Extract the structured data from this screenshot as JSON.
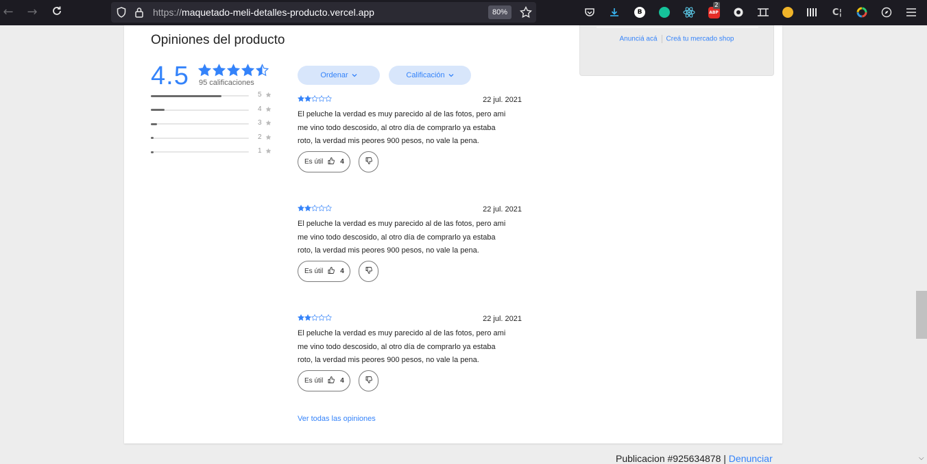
{
  "browser": {
    "url_protocol": "https://",
    "url_host": "maquetado-meli-detalles-producto.vercel.app",
    "zoom": "80%",
    "abp_badge": "2",
    "extension_b_label": "B",
    "icons": [
      "back-icon",
      "forward-icon",
      "reload-icon",
      "shield-icon",
      "lock-icon",
      "star-icon",
      "pocket-icon",
      "download-icon",
      "grammarly-icon",
      "react-icon",
      "adblock-icon",
      "extension-icons",
      "menu-icon"
    ]
  },
  "sidebar_box": {
    "link_announce": "Anunciá acá",
    "link_shop": "Creá tu mercado shop"
  },
  "reviews_section": {
    "title": "Opiniones del producto",
    "average": "4.5",
    "average_value": 4.5,
    "ratings_count_label": "95 calificaciones",
    "distribution": [
      {
        "label": "5",
        "fraction": 0.72
      },
      {
        "label": "4",
        "fraction": 0.14
      },
      {
        "label": "3",
        "fraction": 0.06
      },
      {
        "label": "2",
        "fraction": 0.03
      },
      {
        "label": "1",
        "fraction": 0.02
      }
    ],
    "filters": {
      "order_label": "Ordenar",
      "rating_label": "Calificación"
    },
    "reviews": [
      {
        "stars": 2,
        "date": "22 jul. 2021",
        "lines": [
          "El peluche la verdad es muy parecido al de las fotos, pero ami",
          "me vino todo descosido, al otro día de comprarlo ya estaba",
          "roto, la verdad mis peores 900 pesos, no vale la pena."
        ],
        "useful_label": "Es útil",
        "useful_count": "4"
      },
      {
        "stars": 2,
        "date": "22 jul. 2021",
        "lines": [
          "El peluche la verdad es muy parecido al de las fotos, pero ami",
          "me vino todo descosido, al otro día de comprarlo ya estaba",
          "roto, la verdad mis peores 900 pesos, no vale la pena."
        ],
        "useful_label": "Es útil",
        "useful_count": "4"
      },
      {
        "stars": 2,
        "date": "22 jul. 2021",
        "lines": [
          "El peluche la verdad es muy parecido al de las fotos, pero ami",
          "me vino todo descosido, al otro día de comprarlo ya estaba",
          "roto, la verdad mis peores 900 pesos, no vale la pena."
        ],
        "useful_label": "Es útil",
        "useful_count": "4"
      }
    ],
    "see_all_label": "Ver todas las opiniones"
  },
  "footer": {
    "publication_label": "Publicacion",
    "publication_id": "#925634878",
    "separator": "|",
    "report_label": "Denunciar"
  },
  "colors": {
    "accent": "#3483fa",
    "browser_bg": "#1c1b22",
    "page_bg": "#ededed"
  }
}
